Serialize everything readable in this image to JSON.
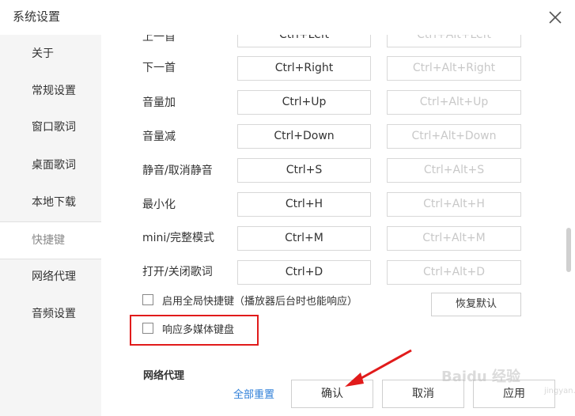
{
  "window": {
    "title": "系统设置",
    "close_icon": "close-icon"
  },
  "sidebar": {
    "items": [
      {
        "label": "关于"
      },
      {
        "label": "常规设置"
      },
      {
        "label": "窗口歌词"
      },
      {
        "label": "桌面歌词"
      },
      {
        "label": "本地下载"
      },
      {
        "label": "快捷键"
      },
      {
        "label": "网络代理"
      },
      {
        "label": "音频设置"
      }
    ],
    "active_index": 5
  },
  "shortcuts": {
    "rows": [
      {
        "label": "上一首",
        "main": "Ctrl+Left",
        "alt": "Ctrl+Alt+Left"
      },
      {
        "label": "下一首",
        "main": "Ctrl+Right",
        "alt": "Ctrl+Alt+Right"
      },
      {
        "label": "音量加",
        "main": "Ctrl+Up",
        "alt": "Ctrl+Alt+Up"
      },
      {
        "label": "音量减",
        "main": "Ctrl+Down",
        "alt": "Ctrl+Alt+Down"
      },
      {
        "label": "静音/取消静音",
        "main": "Ctrl+S",
        "alt": "Ctrl+Alt+S"
      },
      {
        "label": "最小化",
        "main": "Ctrl+H",
        "alt": "Ctrl+Alt+H"
      },
      {
        "label": "mini/完整模式",
        "main": "Ctrl+M",
        "alt": "Ctrl+Alt+M"
      },
      {
        "label": "打开/关闭歌词",
        "main": "Ctrl+D",
        "alt": "Ctrl+Alt+D"
      }
    ],
    "global_hotkey_label": "启用全局快捷键（播放器后台时也能响应）",
    "global_hotkey_checked": false,
    "restore_default_label": "恢复默认",
    "media_keyboard_label": "响应多媒体键盘",
    "media_keyboard_checked": false
  },
  "next_section_title": "网络代理",
  "footer": {
    "reset_all_label": "全部重置",
    "confirm_label": "确认",
    "cancel_label": "取消",
    "apply_label": "应用"
  },
  "colors": {
    "highlight": "#e11b1b",
    "link": "#2f7fd8"
  },
  "watermark": {
    "text": "Baidu 经验",
    "sub": "jingyan.baidu.com"
  }
}
